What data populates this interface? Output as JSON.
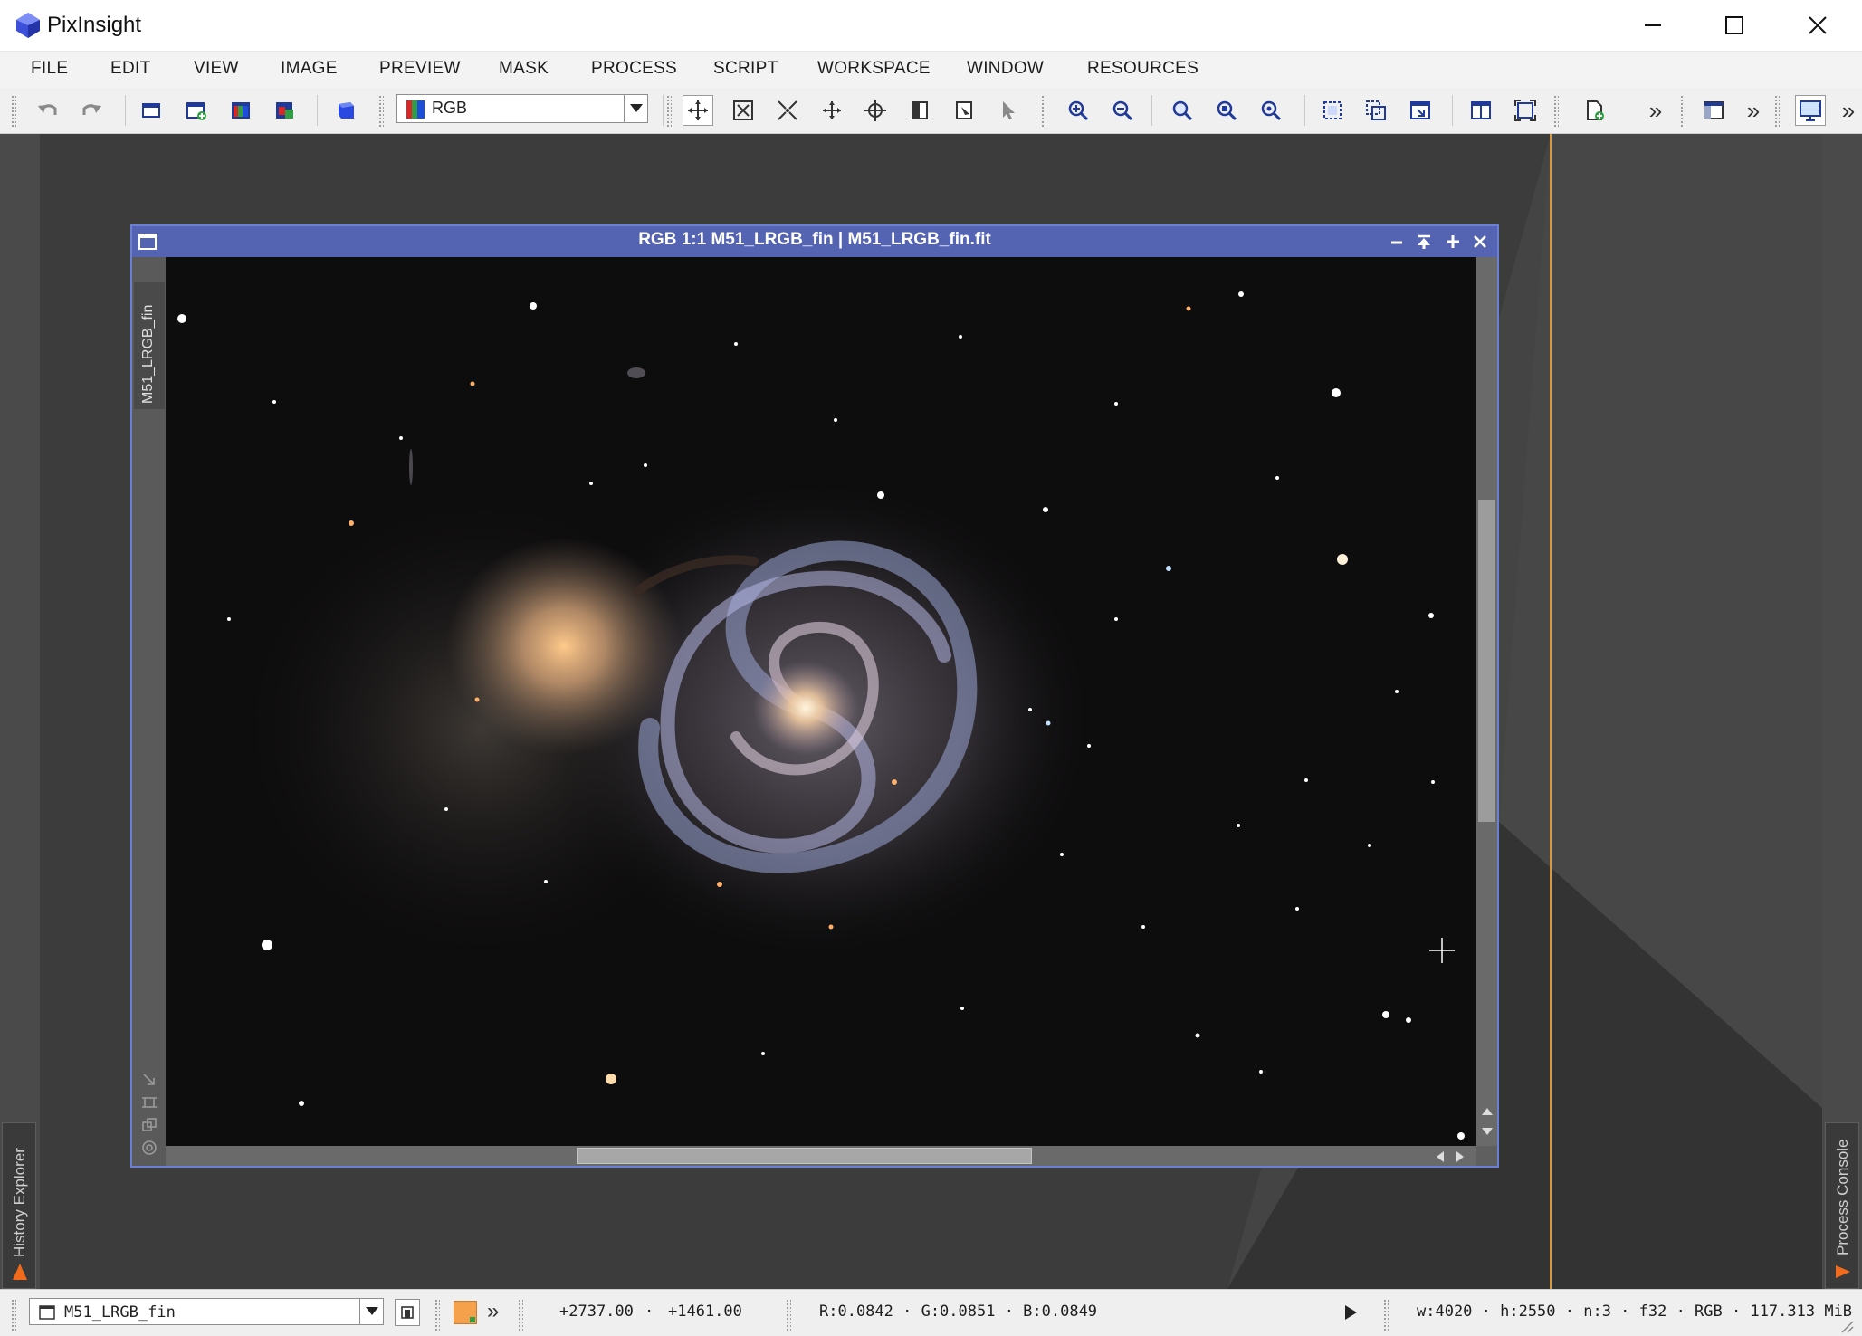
{
  "app": {
    "title": "PixInsight"
  },
  "menu": {
    "items": [
      "FILE",
      "EDIT",
      "VIEW",
      "IMAGE",
      "PREVIEW",
      "MASK",
      "PROCESS",
      "SCRIPT",
      "WORKSPACE",
      "WINDOW",
      "RESOURCES"
    ]
  },
  "toolbar": {
    "channel_select": "RGB",
    "overflow_glyph": "»"
  },
  "image_window": {
    "title": "RGB 1:1 M51_LRGB_fin | M51_LRGB_fin.fit",
    "view_id": "M51_LRGB_fin"
  },
  "sidebar": {
    "history_label": "History Explorer",
    "console_label": "Process Console"
  },
  "status": {
    "view_select": "M51_LRGB_fin",
    "overflow_glyph": "»",
    "x": "+2737.00",
    "y": "+1461.00",
    "sep": "·",
    "rgb": "R:0.0842 · G:0.0851 · B:0.0849",
    "info": "w:4020 · h:2550 · n:3 · f32 · RGB · 117.313 MiB"
  },
  "colors": {
    "title_bar": "#5464b2",
    "accent_swatch": "#f5a04a",
    "guide_line": "#d69a3a"
  }
}
